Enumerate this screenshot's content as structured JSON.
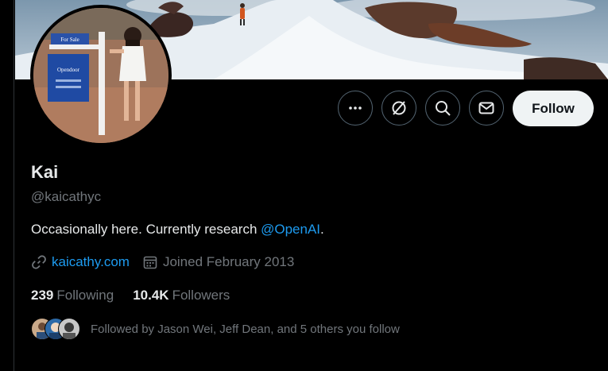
{
  "profile": {
    "name": "Kai",
    "handle": "@kaicathyc",
    "bio_text": "Occasionally here. Currently research ",
    "bio_mention": "@OpenAI",
    "bio_end": ".",
    "website": "kaicathy.com",
    "joined": "Joined February 2013",
    "following_count": "239",
    "following_label": "Following",
    "followers_count": "10.4K",
    "followers_label": "Followers",
    "followed_by": "Followed by Jason Wei, Jeff Dean, and 5 others you follow"
  },
  "avatar": {
    "sign_top": "For Sale",
    "sign_brand": "Opendoor"
  },
  "actions": {
    "follow_label": "Follow",
    "more_icon": "more-icon",
    "grok_icon": "grok-icon",
    "search_icon": "search-icon",
    "message_icon": "message-icon"
  },
  "colors": {
    "accent": "#1d9bf0",
    "follow_bg": "#eff3f4",
    "secondary_text": "#71767b"
  }
}
